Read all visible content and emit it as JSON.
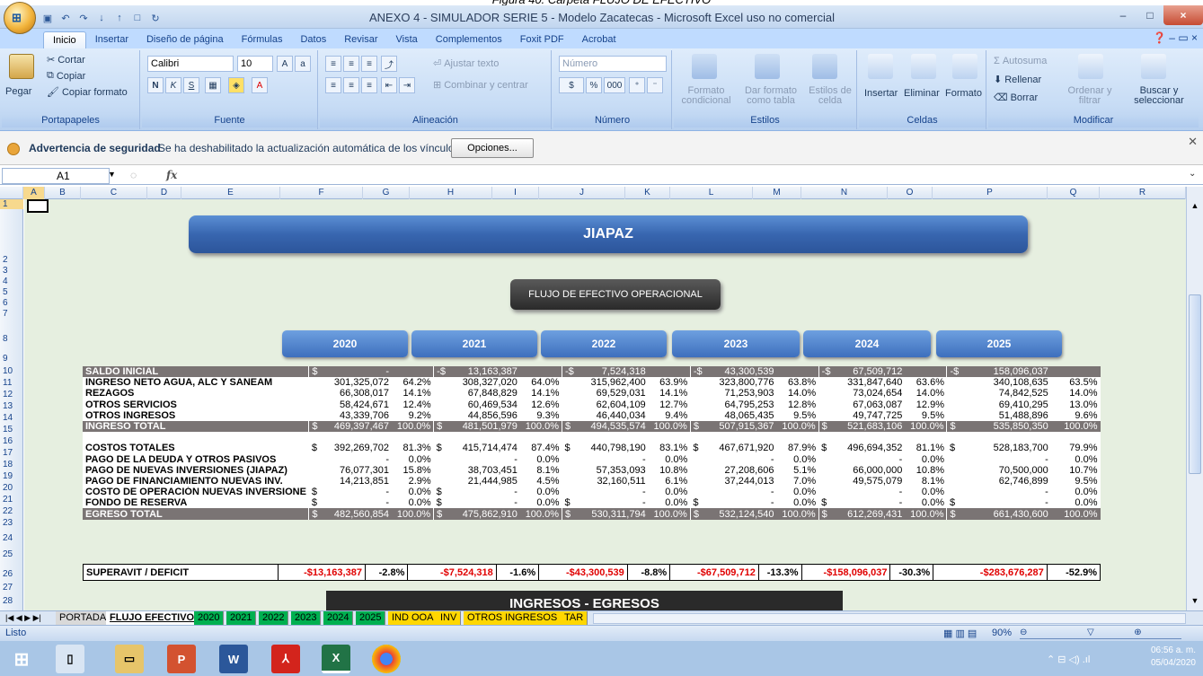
{
  "caption": "Figura 40. Carpeta FLUJO DE EFECTIVO",
  "window": {
    "title": "ANEXO 4 - SIMULADOR SERIE 5 - Modelo Zacatecas - Microsoft Excel uso no comercial",
    "minimize": "–",
    "maximize": "□",
    "close": "×"
  },
  "ribbon_tabs": [
    "Inicio",
    "Insertar",
    "Diseño de página",
    "Fórmulas",
    "Datos",
    "Revisar",
    "Vista",
    "Complementos",
    "Foxit PDF",
    "Acrobat"
  ],
  "ribbon": {
    "clipboard": {
      "paste": "Pegar",
      "cut": "Cortar",
      "copy": "Copiar",
      "format_painter": "Copiar formato",
      "label": "Portapapeles"
    },
    "font": {
      "name": "Calibri",
      "size": "10",
      "bold": "N",
      "italic": "K",
      "underline": "S",
      "label": "Fuente"
    },
    "alignment": {
      "wrap": "Ajustar texto",
      "merge": "Combinar y centrar",
      "label": "Alineación"
    },
    "number": {
      "format": "Número",
      "currency": "$",
      "percent": "%",
      "thousands": "000",
      "label": "Número"
    },
    "styles": {
      "conditional": "Formato condicional",
      "as_table": "Dar formato como tabla",
      "cell_styles": "Estilos de celda",
      "label": "Estilos"
    },
    "cells": {
      "insert": "Insertar",
      "delete": "Eliminar",
      "format": "Formato",
      "label": "Celdas"
    },
    "editing": {
      "autosum": "Autosuma",
      "fill": "Rellenar",
      "clear": "Borrar",
      "sort": "Ordenar y filtrar",
      "find": "Buscar y seleccionar",
      "label": "Modificar"
    }
  },
  "security": {
    "title": "Advertencia de seguridad",
    "message": "Se ha deshabilitado la actualización automática de los vínculos",
    "button": "Opciones..."
  },
  "formula_bar": {
    "name_box": "A1",
    "fx": "fx",
    "value": ""
  },
  "columns": [
    "A",
    "B",
    "C",
    "D",
    "E",
    "F",
    "G",
    "H",
    "I",
    "J",
    "K",
    "L",
    "M",
    "N",
    "O",
    "P",
    "Q",
    "R"
  ],
  "rows": [
    "1",
    "2",
    "3",
    "4",
    "5",
    "6",
    "7",
    "8",
    "9",
    "10",
    "11",
    "12",
    "13",
    "14",
    "15",
    "16",
    "17",
    "18",
    "19",
    "20",
    "21",
    "22",
    "23",
    "24",
    "25",
    "26",
    "27",
    "28"
  ],
  "banner": "JIAPAZ",
  "section": "FLUJO DE EFECTIVO  OPERACIONAL",
  "years": [
    "2020",
    "2021",
    "2022",
    "2023",
    "2024",
    "2025"
  ],
  "table": [
    {
      "label": "SALDO INICIAL",
      "style": "dark",
      "cells": [
        "$",
        "-",
        "",
        "-$",
        "13,163,387",
        "",
        "-$",
        "7,524,318",
        "",
        "-$",
        "43,300,539",
        "",
        "-$",
        "67,509,712",
        "",
        "-$",
        "158,096,037",
        ""
      ]
    },
    {
      "label": "INGRESO NETO AGUA, ALC Y SANEAM",
      "style": "white",
      "cells": [
        "",
        "301,325,072",
        "64.2%",
        "",
        "308,327,020",
        "64.0%",
        "",
        "315,962,400",
        "63.9%",
        "",
        "323,800,776",
        "63.8%",
        "",
        "331,847,640",
        "63.6%",
        "",
        "340,108,635",
        "63.5%"
      ]
    },
    {
      "label": "REZAGOS",
      "style": "white",
      "cells": [
        "",
        "66,308,017",
        "14.1%",
        "",
        "67,848,829",
        "14.1%",
        "",
        "69,529,031",
        "14.1%",
        "",
        "71,253,903",
        "14.0%",
        "",
        "73,024,654",
        "14.0%",
        "",
        "74,842,525",
        "14.0%"
      ]
    },
    {
      "label": "OTROS SERVICIOS",
      "style": "white",
      "cells": [
        "",
        "58,424,671",
        "12.4%",
        "",
        "60,469,534",
        "12.6%",
        "",
        "62,604,109",
        "12.7%",
        "",
        "64,795,253",
        "12.8%",
        "",
        "67,063,087",
        "12.9%",
        "",
        "69,410,295",
        "13.0%"
      ]
    },
    {
      "label": "OTROS INGRESOS",
      "style": "white",
      "cells": [
        "",
        "43,339,706",
        "9.2%",
        "",
        "44,856,596",
        "9.3%",
        "",
        "46,440,034",
        "9.4%",
        "",
        "48,065,435",
        "9.5%",
        "",
        "49,747,725",
        "9.5%",
        "",
        "51,488,896",
        "9.6%"
      ]
    },
    {
      "label": "INGRESO TOTAL",
      "style": "dark",
      "cells": [
        "$",
        "469,397,467",
        "100.0%",
        "$",
        "481,501,979",
        "100.0%",
        "$",
        "494,535,574",
        "100.0%",
        "$",
        "507,915,367",
        "100.0%",
        "$",
        "521,683,106",
        "100.0%",
        "$",
        "535,850,350",
        "100.0%"
      ]
    },
    {
      "label": "",
      "style": "white",
      "cells": [
        "",
        "",
        "",
        "",
        "",
        "",
        "",
        "",
        "",
        "",
        "",
        "",
        "",
        "",
        "",
        "",
        "",
        ""
      ]
    },
    {
      "label": "COSTOS TOTALES",
      "style": "white",
      "cells": [
        "$",
        "392,269,702",
        "81.3%",
        "$",
        "415,714,474",
        "87.4%",
        "$",
        "440,798,190",
        "83.1%",
        "$",
        "467,671,920",
        "87.9%",
        "$",
        "496,694,352",
        "81.1%",
        "$",
        "528,183,700",
        "79.9%"
      ]
    },
    {
      "label": "PAGO DE LA DEUDA Y OTROS PASIVOS",
      "style": "white",
      "cells": [
        "",
        "-",
        "0.0%",
        "",
        "-",
        "0.0%",
        "",
        "-",
        "0.0%",
        "",
        "-",
        "0.0%",
        "",
        "-",
        "0.0%",
        "",
        "-",
        "0.0%"
      ]
    },
    {
      "label": "PAGO DE NUEVAS INVERSIONES (JIAPAZ)",
      "style": "white",
      "cells": [
        "",
        "76,077,301",
        "15.8%",
        "",
        "38,703,451",
        "8.1%",
        "",
        "57,353,093",
        "10.8%",
        "",
        "27,208,606",
        "5.1%",
        "",
        "66,000,000",
        "10.8%",
        "",
        "70,500,000",
        "10.7%"
      ]
    },
    {
      "label": "PAGO DE FINANCIAMIENTO NUEVAS INV.",
      "style": "white",
      "cells": [
        "",
        "14,213,851",
        "2.9%",
        "",
        "21,444,985",
        "4.5%",
        "",
        "32,160,511",
        "6.1%",
        "",
        "37,244,013",
        "7.0%",
        "",
        "49,575,079",
        "8.1%",
        "",
        "62,746,899",
        "9.5%"
      ]
    },
    {
      "label": "COSTO DE OPERACIÓN NUEVAS INVERSIONE",
      "style": "white",
      "cells": [
        "$",
        "-",
        "0.0%",
        "$",
        "-",
        "0.0%",
        "",
        "-",
        "0.0%",
        "",
        "-",
        "0.0%",
        "",
        "-",
        "0.0%",
        "",
        "-",
        "0.0%"
      ]
    },
    {
      "label": "FONDO DE RESERVA",
      "style": "white",
      "cells": [
        "$",
        "-",
        "0.0%",
        "$",
        "-",
        "0.0%",
        "$",
        "-",
        "0.0%",
        "$",
        "-",
        "0.0%",
        "$",
        "-",
        "0.0%",
        "$",
        "-",
        "0.0%"
      ]
    },
    {
      "label": "EGRESO TOTAL",
      "style": "dark",
      "cells": [
        "$",
        "482,560,854",
        "100.0%",
        "$",
        "475,862,910",
        "100.0%",
        "$",
        "530,311,794",
        "100.0%",
        "$",
        "532,124,540",
        "100.0%",
        "$",
        "612,269,431",
        "100.0%",
        "$",
        "661,430,600",
        "100.0%"
      ]
    }
  ],
  "superavit": {
    "label": "SUPERAVIT / DEFICIT",
    "values": [
      "-$13,163,387",
      "-2.8%",
      "-$7,524,318",
      "-1.6%",
      "-$43,300,539",
      "-8.8%",
      "-$67,509,712",
      "-13.3%",
      "-$158,096,037",
      "-30.3%",
      "-$283,676,287",
      "-52.9%"
    ]
  },
  "ingresos_egresos": "INGRESOS - EGRESOS",
  "sheet_tabs": [
    "PORTADA",
    "FLUJO EFECTIVO",
    "2020",
    "2021",
    "2022",
    "2023",
    "2024",
    "2025",
    "IND OOA",
    "INV",
    "OTROS INGRESOS",
    "TAR"
  ],
  "status": {
    "text": "Listo",
    "zoom": "90%"
  },
  "clock": {
    "time": "06:56 a. m.",
    "date": "05/04/2020"
  },
  "colors": {
    "banner": "#3866b0",
    "dark_row": "#7a7474",
    "sheet_bg": "#e6efe0",
    "deficit": "#e00000"
  }
}
